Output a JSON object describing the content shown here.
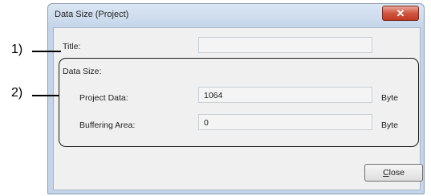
{
  "window": {
    "title": "Data Size (Project)",
    "close_glyph": "✕"
  },
  "fields": {
    "title": {
      "label": "Title:",
      "value": ""
    },
    "data_size_group": "Data Size:",
    "project_data": {
      "label": "Project Data:",
      "value": "1064",
      "unit": "Byte"
    },
    "buffering_area": {
      "label": "Buffering Area:",
      "value": "0",
      "unit": "Byte"
    }
  },
  "buttons": {
    "close_label": "Close"
  },
  "callouts": {
    "c1": "1)",
    "c2": "2)"
  }
}
